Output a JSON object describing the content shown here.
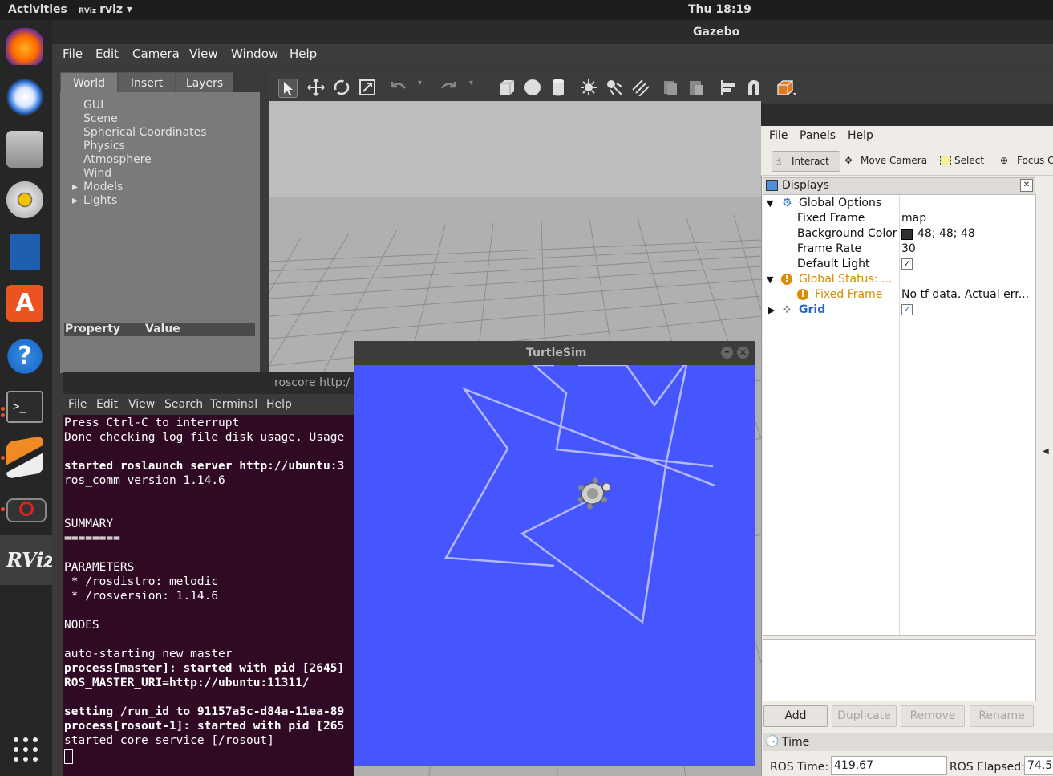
{
  "topbar": {
    "activities": "Activities",
    "app_name": "rviz",
    "app_prefix": "RViz",
    "clock": "Thu 18:19"
  },
  "gazebo": {
    "title": "Gazebo",
    "menu": [
      "File",
      "Edit",
      "Camera",
      "View",
      "Window",
      "Help"
    ],
    "tabs": [
      "World",
      "Insert",
      "Layers"
    ],
    "tree": [
      "GUI",
      "Scene",
      "Spherical Coordinates",
      "Physics",
      "Atmosphere",
      "Wind",
      "Models",
      "Lights"
    ],
    "prop_headers": {
      "property": "Property",
      "value": "Value"
    }
  },
  "rviz": {
    "menu": [
      "File",
      "Panels",
      "Help"
    ],
    "tools": [
      "Interact",
      "Move Camera",
      "Select",
      "Focus Ca"
    ],
    "displays_label": "Displays",
    "global_options": "Global Options",
    "fixed_frame_k": "Fixed Frame",
    "fixed_frame_v": "map",
    "bg_color_k": "Background Color",
    "bg_color_v": "48; 48; 48",
    "frame_rate_k": "Frame Rate",
    "frame_rate_v": "30",
    "default_light_k": "Default Light",
    "global_status": "Global Status: ...",
    "status_fixed_frame": "Fixed Frame",
    "status_msg": "No tf data.  Actual err...",
    "grid": "Grid",
    "buttons": {
      "add": "Add",
      "duplicate": "Duplicate",
      "remove": "Remove",
      "rename": "Rename"
    },
    "time_label": "Time",
    "ros_time_label": "ROS Time:",
    "ros_time_value": "419.67",
    "ros_elapsed_label": "ROS Elapsed:",
    "ros_elapsed_value": "74.5",
    "colors": {
      "warning": "#d98b00",
      "link": "#2466c9",
      "bg_swatch": "#303030"
    }
  },
  "terminal": {
    "title": "roscore http:/",
    "menu": [
      "File",
      "Edit",
      "View",
      "Search",
      "Terminal",
      "Help"
    ],
    "lines": [
      {
        "t": "Press Ctrl-C to interrupt",
        "b": false
      },
      {
        "t": "Done checking log file disk usage. Usage",
        "b": false
      },
      {
        "t": "",
        "b": false
      },
      {
        "t": "started roslaunch server http://ubuntu:3",
        "b": true
      },
      {
        "t": "ros_comm version 1.14.6",
        "b": false
      },
      {
        "t": "",
        "b": false
      },
      {
        "t": "",
        "b": false
      },
      {
        "t": "SUMMARY",
        "b": false
      },
      {
        "t": "========",
        "b": false
      },
      {
        "t": "",
        "b": false
      },
      {
        "t": "PARAMETERS",
        "b": false
      },
      {
        "t": " * /rosdistro: melodic",
        "b": false
      },
      {
        "t": " * /rosversion: 1.14.6",
        "b": false
      },
      {
        "t": "",
        "b": false
      },
      {
        "t": "NODES",
        "b": false
      },
      {
        "t": "",
        "b": false
      },
      {
        "t": "auto-starting new master",
        "b": false
      },
      {
        "t": "process[master]: started with pid [2645]",
        "b": true
      },
      {
        "t": "ROS_MASTER_URI=http://ubuntu:11311/",
        "b": true
      },
      {
        "t": "",
        "b": false
      },
      {
        "t": "setting /run_id to 91157a5c-d84a-11ea-89",
        "b": true
      },
      {
        "t": "process[rosout-1]: started with pid [265",
        "b": true
      },
      {
        "t": "started core service [/rosout]",
        "b": false
      }
    ]
  },
  "turtlesim": {
    "title": "TurtleSim",
    "bg_color": "#4556ff",
    "pen_color": "#b3b8ff"
  }
}
